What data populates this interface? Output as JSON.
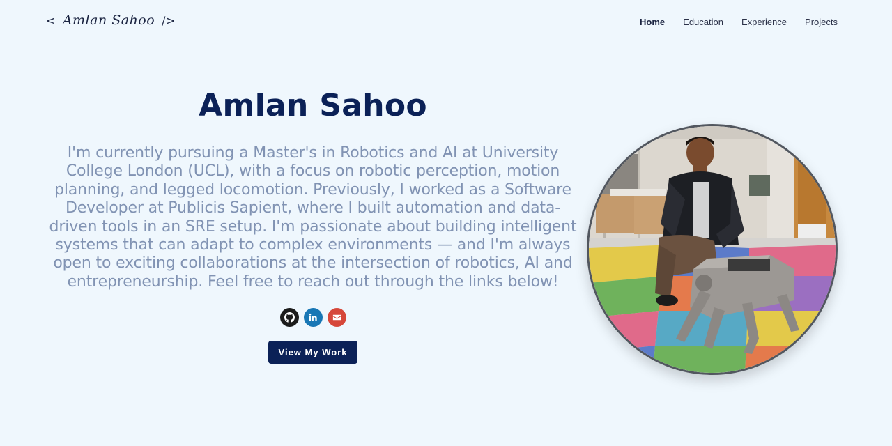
{
  "header": {
    "logo": {
      "open": "<",
      "name": "Amlan Sahoo",
      "close": "/>"
    },
    "nav": [
      {
        "label": "Home",
        "active": true
      },
      {
        "label": "Education",
        "active": false
      },
      {
        "label": "Experience",
        "active": false
      },
      {
        "label": "Projects",
        "active": false
      }
    ]
  },
  "hero": {
    "name": "Amlan Sahoo",
    "bio": "I'm currently pursuing a Master's in Robotics and AI at University College London (UCL), with a focus on robotic perception, motion planning, and legged locomotion. Previously, I worked as a Software Developer at Publicis Sapient, where I built automation and data-driven tools in an SRE setup. I'm passionate about building intelligent systems that can adapt to complex environments — and I'm always open to exciting collaborations at the intersection of robotics, AI and entrepreneurship. Feel free to reach out through the links below!",
    "socials": [
      {
        "name": "github",
        "icon": "github-icon",
        "color": "#1b1b1b"
      },
      {
        "name": "linkedin",
        "icon": "linkedin-icon",
        "color": "#1877b5"
      },
      {
        "name": "email",
        "icon": "envelope-icon",
        "color": "#d6473a"
      }
    ],
    "cta_label": "View My Work",
    "photo_alt": "profile-photo"
  },
  "colors": {
    "background": "#eff7fd",
    "primary": "#0b2157",
    "bio_text": "#8193b3"
  }
}
